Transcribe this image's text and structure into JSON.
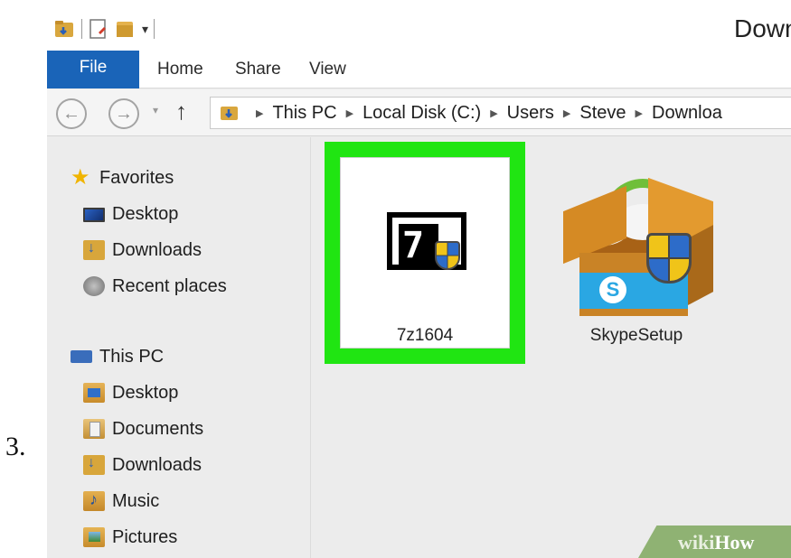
{
  "step": {
    "number": "3."
  },
  "window": {
    "title": "Down"
  },
  "ribbon": {
    "tabs": [
      {
        "label": "File"
      },
      {
        "label": "Home"
      },
      {
        "label": "Share"
      },
      {
        "label": "View"
      }
    ],
    "file_tab_color": "#1a64b8"
  },
  "address": {
    "breadcrumbs": [
      "This PC",
      "Local Disk (C:)",
      "Users",
      "Steve",
      "Downloa"
    ]
  },
  "sidebar": {
    "favorites": {
      "label": "Favorites",
      "items": [
        {
          "label": "Desktop",
          "icon": "desktop-icon"
        },
        {
          "label": "Downloads",
          "icon": "downloads-folder-icon"
        },
        {
          "label": "Recent places",
          "icon": "recent-places-icon"
        }
      ]
    },
    "this_pc": {
      "label": "This PC",
      "items": [
        {
          "label": "Desktop",
          "icon": "desktop-folder-icon"
        },
        {
          "label": "Documents",
          "icon": "documents-folder-icon"
        },
        {
          "label": "Downloads",
          "icon": "downloads-folder-icon"
        },
        {
          "label": "Music",
          "icon": "music-folder-icon"
        },
        {
          "label": "Pictures",
          "icon": "pictures-folder-icon"
        }
      ]
    }
  },
  "files": [
    {
      "name": "7z1604",
      "icon": "7zip-installer-icon",
      "selected": true
    },
    {
      "name": "SkypeSetup",
      "icon": "skype-installer-icon",
      "selected": false
    }
  ],
  "highlight_color": "#20e512",
  "watermark": {
    "brand_wiki": "wiki",
    "brand_how": "How"
  }
}
